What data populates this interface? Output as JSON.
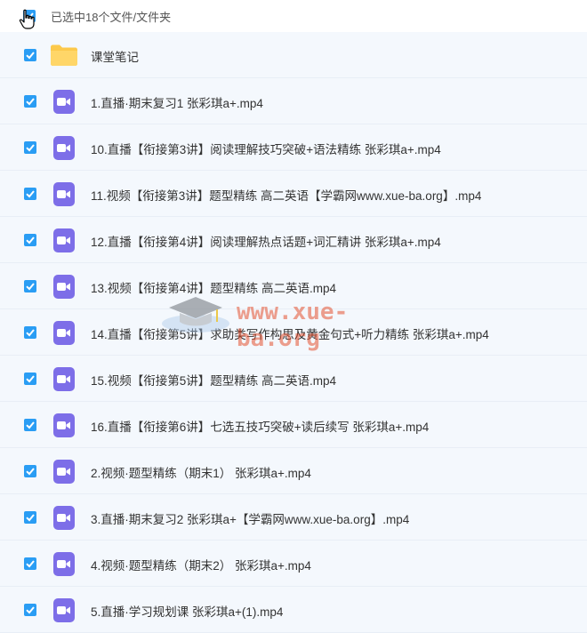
{
  "selection": {
    "summary": "已选中18个文件/文件夹",
    "checked": true
  },
  "rows": [
    {
      "type": "folder",
      "name": "课堂笔记",
      "checked": true,
      "icon": "folder-icon"
    },
    {
      "type": "video",
      "name": "1.直播·期末复习1 张彩琪a+.mp4",
      "checked": true,
      "icon": "video-file-icon"
    },
    {
      "type": "video",
      "name": "10.直播【衔接第3讲】阅读理解技巧突破+语法精练 张彩琪a+.mp4",
      "checked": true,
      "icon": "video-file-icon"
    },
    {
      "type": "video",
      "name": "11.视频【衔接第3讲】题型精练 高二英语【学霸网www.xue-ba.org】.mp4",
      "checked": true,
      "icon": "video-file-icon"
    },
    {
      "type": "video",
      "name": "12.直播【衔接第4讲】阅读理解热点话题+词汇精讲 张彩琪a+.mp4",
      "checked": true,
      "icon": "video-file-icon"
    },
    {
      "type": "video",
      "name": "13.视频【衔接第4讲】题型精练 高二英语.mp4",
      "checked": true,
      "icon": "video-file-icon"
    },
    {
      "type": "video",
      "name": "14.直播【衔接第5讲】求助类写作构思及黄金句式+听力精练 张彩琪a+.mp4",
      "checked": true,
      "icon": "video-file-icon"
    },
    {
      "type": "video",
      "name": "15.视频【衔接第5讲】题型精练 高二英语.mp4",
      "checked": true,
      "icon": "video-file-icon"
    },
    {
      "type": "video",
      "name": "16.直播【衔接第6讲】七选五技巧突破+读后续写 张彩琪a+.mp4",
      "checked": true,
      "icon": "video-file-icon"
    },
    {
      "type": "video",
      "name": "2.视频·题型精练（期末1） 张彩琪a+.mp4",
      "checked": true,
      "icon": "video-file-icon"
    },
    {
      "type": "video",
      "name": "3.直播·期末复习2 张彩琪a+【学霸网www.xue-ba.org】.mp4",
      "checked": true,
      "icon": "video-file-icon"
    },
    {
      "type": "video",
      "name": "4.视频·题型精练（期末2） 张彩琪a+.mp4",
      "checked": true,
      "icon": "video-file-icon"
    },
    {
      "type": "video",
      "name": "5.直播·学习规划课 张彩琪a+(1).mp4",
      "checked": true,
      "icon": "video-file-icon"
    }
  ],
  "watermark": {
    "text": "www.xue-ba.org"
  },
  "colors": {
    "checkbox": "#2a9df4",
    "video_icon": "#7d6ee8",
    "folder": "#fcc94b",
    "row_bg": "#f4f8fd",
    "watermark": "#e4441f"
  }
}
